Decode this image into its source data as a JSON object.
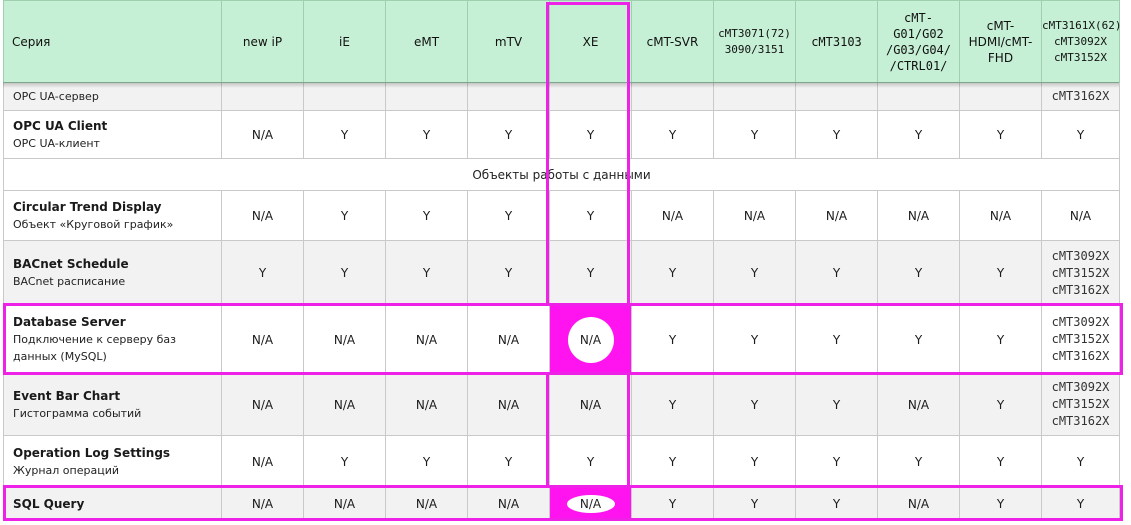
{
  "columns": {
    "series": "Серия",
    "c1": "new iP",
    "c2": "iE",
    "c3": "eMT",
    "c4": "mTV",
    "c5": "XE",
    "c6": "cMT-SVR",
    "c7": [
      "cMT3071(72)",
      "3090/3151"
    ],
    "c8": "cMT3103",
    "c9": [
      "cMT-",
      "G01/G02",
      "/G03/G04/",
      "/CTRL01/"
    ],
    "c10": [
      "cMT-",
      "HDMI/cMT-",
      "FHD"
    ],
    "c11": [
      "cMT3161X(62)",
      "cMT3092X",
      "cMT3152X"
    ]
  },
  "partial_row": {
    "ru": "OPC UA-сервер",
    "last": "cMT3162X"
  },
  "rows": {
    "opc_client": {
      "en": "OPC UA Client",
      "ru": "OPC UA-клиент",
      "v": [
        "N/A",
        "Y",
        "Y",
        "Y",
        "Y",
        "Y",
        "Y",
        "Y",
        "Y",
        "Y",
        "Y"
      ]
    },
    "section": "Объекты работы с данными",
    "circular_trend": {
      "en": "Circular Trend Display",
      "ru": "Объект «Круговой график»",
      "v": [
        "N/A",
        "Y",
        "Y",
        "Y",
        "Y",
        "N/A",
        "N/A",
        "N/A",
        "N/A",
        "N/A",
        "N/A"
      ]
    },
    "bacnet": {
      "en": "BACnet Schedule",
      "ru": "BACnet расписание",
      "v": [
        "Y",
        "Y",
        "Y",
        "Y",
        "Y",
        "Y",
        "Y",
        "Y",
        "Y",
        "Y"
      ],
      "last": [
        "cMT3092X",
        "cMT3152X",
        "cMT3162X"
      ]
    },
    "db_server": {
      "en": "Database Server",
      "ru": [
        "Подключение к серверу баз",
        "данных (MySQL)"
      ],
      "v": [
        "N/A",
        "N/A",
        "N/A",
        "N/A",
        "N/A",
        "Y",
        "Y",
        "Y",
        "Y",
        "Y"
      ],
      "last": [
        "cMT3092X",
        "cMT3152X",
        "cMT3162X"
      ]
    },
    "event_bar": {
      "en": "Event Bar Chart",
      "ru": "Гистограмма событий",
      "v": [
        "N/A",
        "N/A",
        "N/A",
        "N/A",
        "N/A",
        "Y",
        "Y",
        "Y",
        "N/A",
        "Y"
      ],
      "last": [
        "cMT3092X",
        "cMT3152X",
        "cMT3162X"
      ]
    },
    "op_log": {
      "en": "Operation Log Settings",
      "ru": "Журнал операций",
      "v": [
        "N/A",
        "Y",
        "Y",
        "Y",
        "Y",
        "Y",
        "Y",
        "Y",
        "Y",
        "Y",
        "Y"
      ]
    },
    "sql_query": {
      "en": "SQL Query",
      "v": [
        "N/A",
        "N/A",
        "N/A",
        "N/A",
        "N/A",
        "Y",
        "Y",
        "Y",
        "N/A",
        "Y",
        "Y"
      ]
    }
  },
  "colors": {
    "header_bg": "#c6f0d5",
    "highlight": "#ee22e6",
    "xe_fill": "#ff14f0",
    "row_alt": "#f2f2f2"
  }
}
